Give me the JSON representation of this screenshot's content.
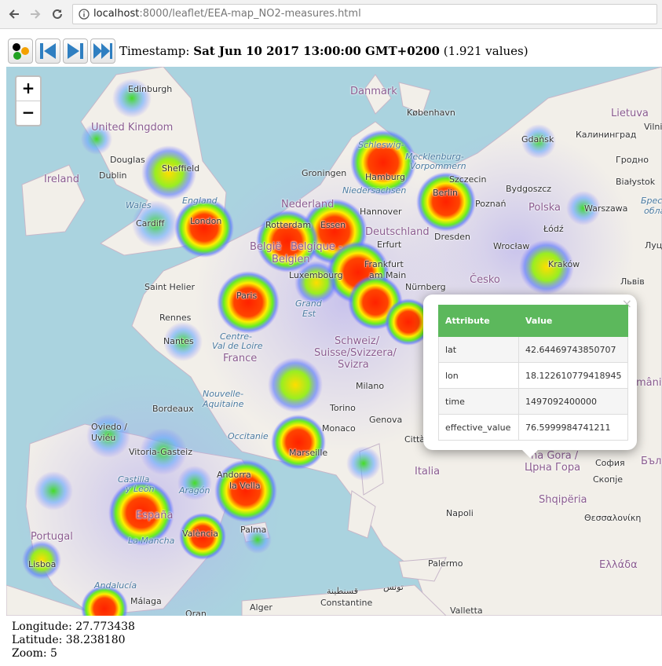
{
  "browser": {
    "url_host": "localhost",
    "url_rest": ":8000/leaflet/EEA-map_NO2-measures.html"
  },
  "toolbar": {
    "timestamp_label": "Timestamp:",
    "timestamp_value": "Sat Jun 10 2017 13:00:00 GMT+0200",
    "values_count": "(1.921 values)"
  },
  "map": {
    "zoom_in": "+",
    "zoom_out": "−",
    "labels": {
      "uk": "United Kingdom",
      "ireland": "Ireland",
      "edinburgh": "Edinburgh",
      "douglas": "Douglas",
      "dublin": "Dublin",
      "sheffield": "Sheffield",
      "wales": "Wales",
      "england": "England",
      "cardiff": "Cardiff",
      "london": "London",
      "danmark": "Danmark",
      "kobenhavn": "København",
      "schleswig": "Schleswig-",
      "mecklenburg": "Mecklenburg-",
      "vorpommern": "Vorpommern",
      "groningen": "Groningen",
      "hamburg": "Hamburg",
      "niedersachsen": "Niedersachsen",
      "nederland": "Nederland",
      "hannover": "Hannover",
      "rotterdam": "Rotterdam",
      "essen": "Essen",
      "deutschland": "Deutschland",
      "erfurt": "Erfurt",
      "dresden": "Dresden",
      "belgie": "België",
      "belgique": "Belgique -",
      "belgien": "Belgien",
      "frankfurt": "Frankfurt",
      "am_main": "am Main",
      "luxembourg": "Luxembourg",
      "nurnberg": "Nürnberg",
      "saint_helier": "Saint Helier",
      "paris": "Paris",
      "grand": "Grand",
      "est": "Est",
      "rennes": "Rennes",
      "centre": "Centre-",
      "val_de_loire": "Val de Loire",
      "nantes": "Nantes",
      "france": "France",
      "schweiz": "Schweiz/",
      "suisse": "Suisse/Svizzera/",
      "svizra": "Svizra",
      "nouvelle": "Nouvelle-",
      "aquitaine": "Aquitaine",
      "bordeaux": "Bordeaux",
      "milano": "Milano",
      "torino": "Torino",
      "genova": "Genova",
      "monaco": "Monaco",
      "occitanie": "Occitanie",
      "marseille": "Marseille",
      "citta": "Città",
      "oviedo": "Oviedo /",
      "uvieu": "Uviéu",
      "vitoria": "Vitoria-Gasteiz",
      "andorra": "Andorra",
      "la_vella": "la Vella",
      "castilla": "Castilla",
      "y_leon": "y León",
      "aragon": "Aragón",
      "espana": "España",
      "la_mancha": "La Mancha",
      "valencia": "València",
      "palma": "Palma",
      "portugal": "Portugal",
      "lisboa": "Lisboa",
      "andalucia": "Andalucía",
      "malaga": "Málaga",
      "oran": "Oran",
      "alger": "Alger",
      "constantine": "Constantine",
      "constantine_ar": "قسنطينة",
      "tunis": "تونس",
      "valletta": "Valletta",
      "palermo": "Palermo",
      "italia": "Italia",
      "napoli": "Napoli",
      "lietuva": "Lietuva",
      "vilni": "Vilni",
      "gdansk": "Gdańsk",
      "kaliningrad": "Калининград",
      "grodno": "Гродно",
      "szczecin": "Szczecin",
      "bydgoszcz": "Bydgoszcz",
      "bialystok": "Białystok",
      "berlin": "Berlin",
      "poznan": "Poznań",
      "polska": "Polska",
      "warszawa": "Warszawa",
      "brest": "Брестс",
      "oblast": "облас",
      "lodz": "Łódź",
      "wroclaw": "Wrocław",
      "krakow": "Kraków",
      "lutsk": "Луц",
      "cesko": "Česko",
      "lviv": "Львів",
      "gora": "na Gora /",
      "crna_gora": "Црна Гора",
      "sofia": "София",
      "skopje": "Скопје",
      "shqiperia": "Shqipëria",
      "bulgaria": "Бълга",
      "thessaloniki": "Θεσσαλονίκη",
      "ellada": "Ελλάδα",
      "romania": "mânia"
    }
  },
  "popup": {
    "close": "×",
    "headers": [
      "Attribute",
      "Value"
    ],
    "rows": [
      {
        "attr": "lat",
        "value": "42.64469743850707"
      },
      {
        "attr": "lon",
        "value": "18.122610779418945"
      },
      {
        "attr": "time",
        "value": "1497092400000"
      },
      {
        "attr": "effective_value",
        "value": "76.5999984741211"
      }
    ]
  },
  "status": {
    "longitude": "Longitude: 27.773438",
    "latitude": "Latitude: 38.238180",
    "zoom": "Zoom: 5"
  }
}
